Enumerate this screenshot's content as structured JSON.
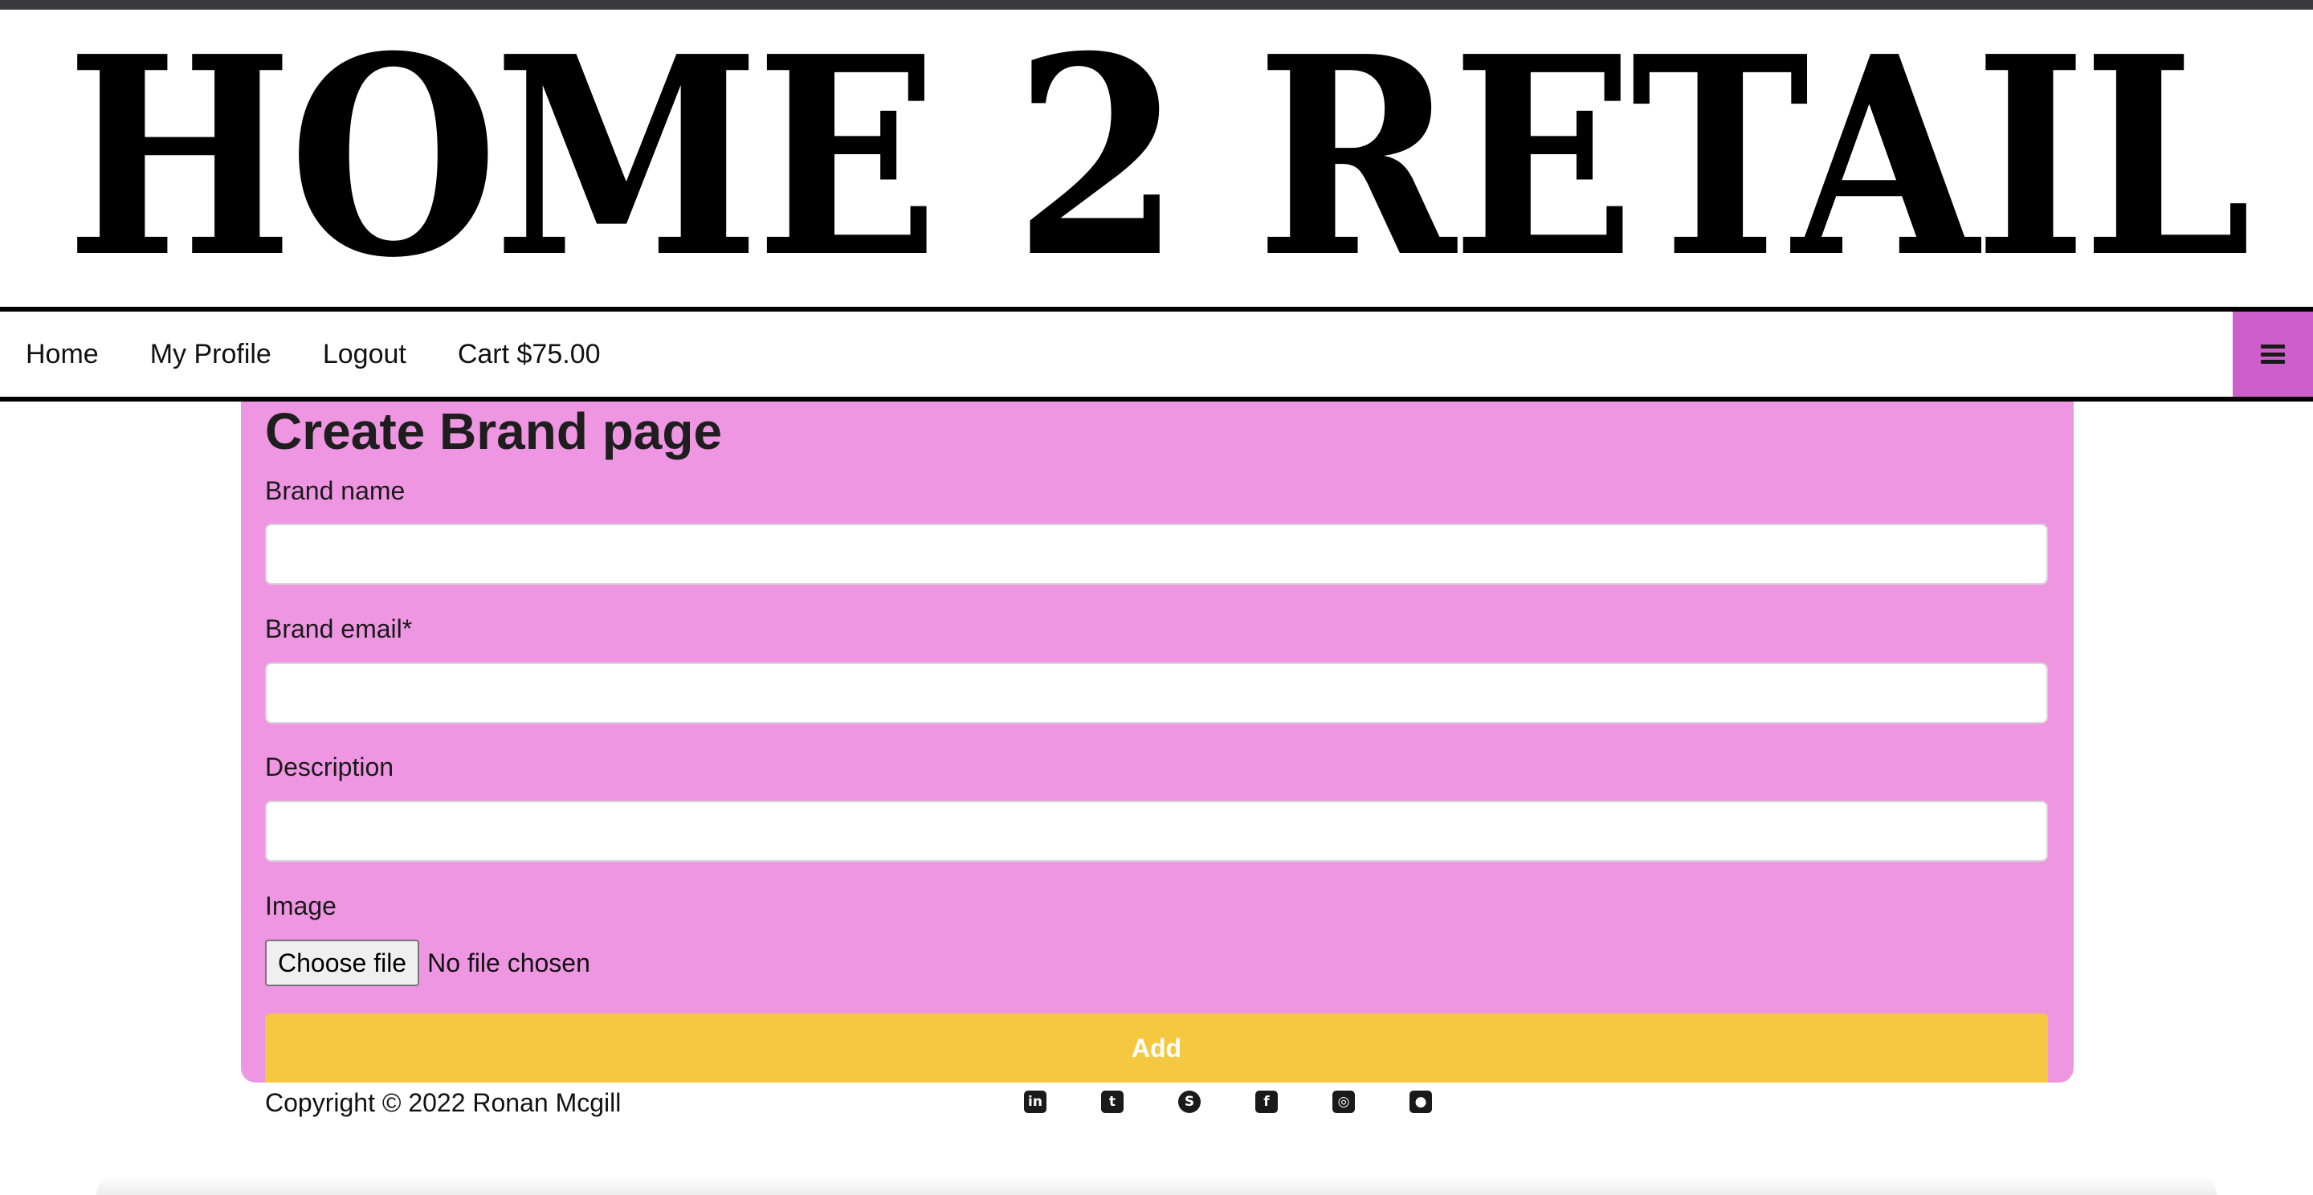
{
  "brand": {
    "logo_text": "HOME 2 RETAIL"
  },
  "nav": {
    "links": [
      "Home",
      "My Profile",
      "Logout",
      "Cart $75.00"
    ],
    "menu_icon": "hamburger-menu-icon",
    "menu_color": "#cc5fc9"
  },
  "form": {
    "title": "Create Brand page",
    "fields": [
      {
        "label": "Brand name",
        "value": "",
        "placeholder": ""
      },
      {
        "label": "Brand email*",
        "value": "",
        "placeholder": ""
      },
      {
        "label": "Description",
        "value": "",
        "placeholder": ""
      }
    ],
    "image": {
      "label": "Image",
      "button": "Choose file",
      "status": "No file chosen"
    },
    "submit_label": "Add",
    "card_color": "#ef96e2",
    "submit_color": "#f5c842"
  },
  "footer": {
    "copyright": "Copyright © 2022 Ronan Mcgill",
    "social_icons": [
      "linkedin-icon",
      "twitter-icon",
      "skype-icon",
      "facebook-icon",
      "instagram-icon",
      "github-icon"
    ]
  }
}
